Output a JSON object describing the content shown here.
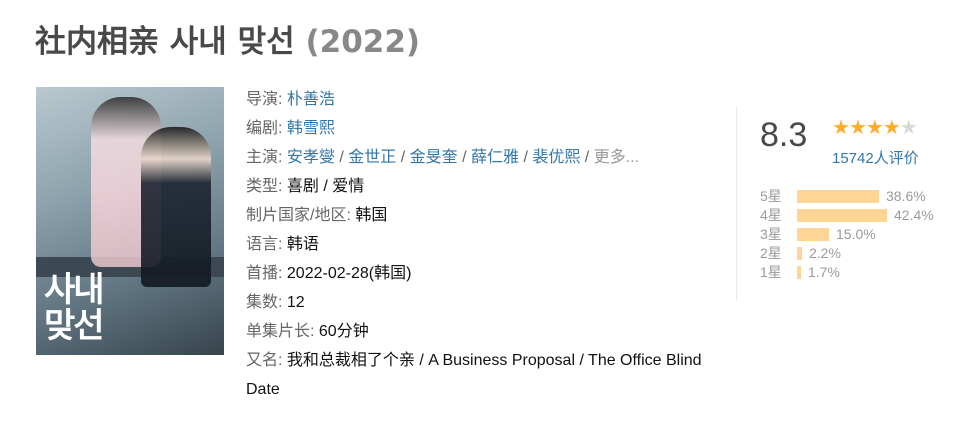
{
  "title": {
    "name": "社内相亲 사내 맞선",
    "year": "(2022)"
  },
  "poster": {
    "overlay_title": "사내\n맞선"
  },
  "info": {
    "director_label": "导演:",
    "director": "朴善浩",
    "writer_label": "编剧:",
    "writer": "韩雪熙",
    "cast_label": "主演:",
    "cast": [
      "安孝燮",
      "金世正",
      "金旻奎",
      "薛仁雅",
      "裴优熙"
    ],
    "cast_sep": " / ",
    "cast_more": "更多...",
    "genre_label": "类型:",
    "genre": "喜剧 / 爱情",
    "country_label": "制片国家/地区:",
    "country": "韩国",
    "language_label": "语言:",
    "language": "韩语",
    "premiere_label": "首播:",
    "premiere": "2022-02-28(韩国)",
    "episodes_label": "集数:",
    "episodes": "12",
    "runtime_label": "单集片长:",
    "runtime": "60分钟",
    "aka_label": "又名:",
    "aka": "我和总裁相了个亲 / A Business Proposal / The Office Blind Date"
  },
  "rating": {
    "score": "8.3",
    "stars_filled": 4,
    "stars_total": 5,
    "votes": "15742人评价",
    "distribution": [
      {
        "label": "5星",
        "percent": "38.6%",
        "value": 38.6
      },
      {
        "label": "4星",
        "percent": "42.4%",
        "value": 42.4
      },
      {
        "label": "3星",
        "percent": "15.0%",
        "value": 15.0
      },
      {
        "label": "2星",
        "percent": "2.2%",
        "value": 2.2
      },
      {
        "label": "1星",
        "percent": "1.7%",
        "value": 1.7
      }
    ],
    "colors": {
      "star_on": "#ffac2d",
      "star_off": "#d9d9d9",
      "bar": "#ffd596",
      "link": "#3377aa"
    }
  }
}
